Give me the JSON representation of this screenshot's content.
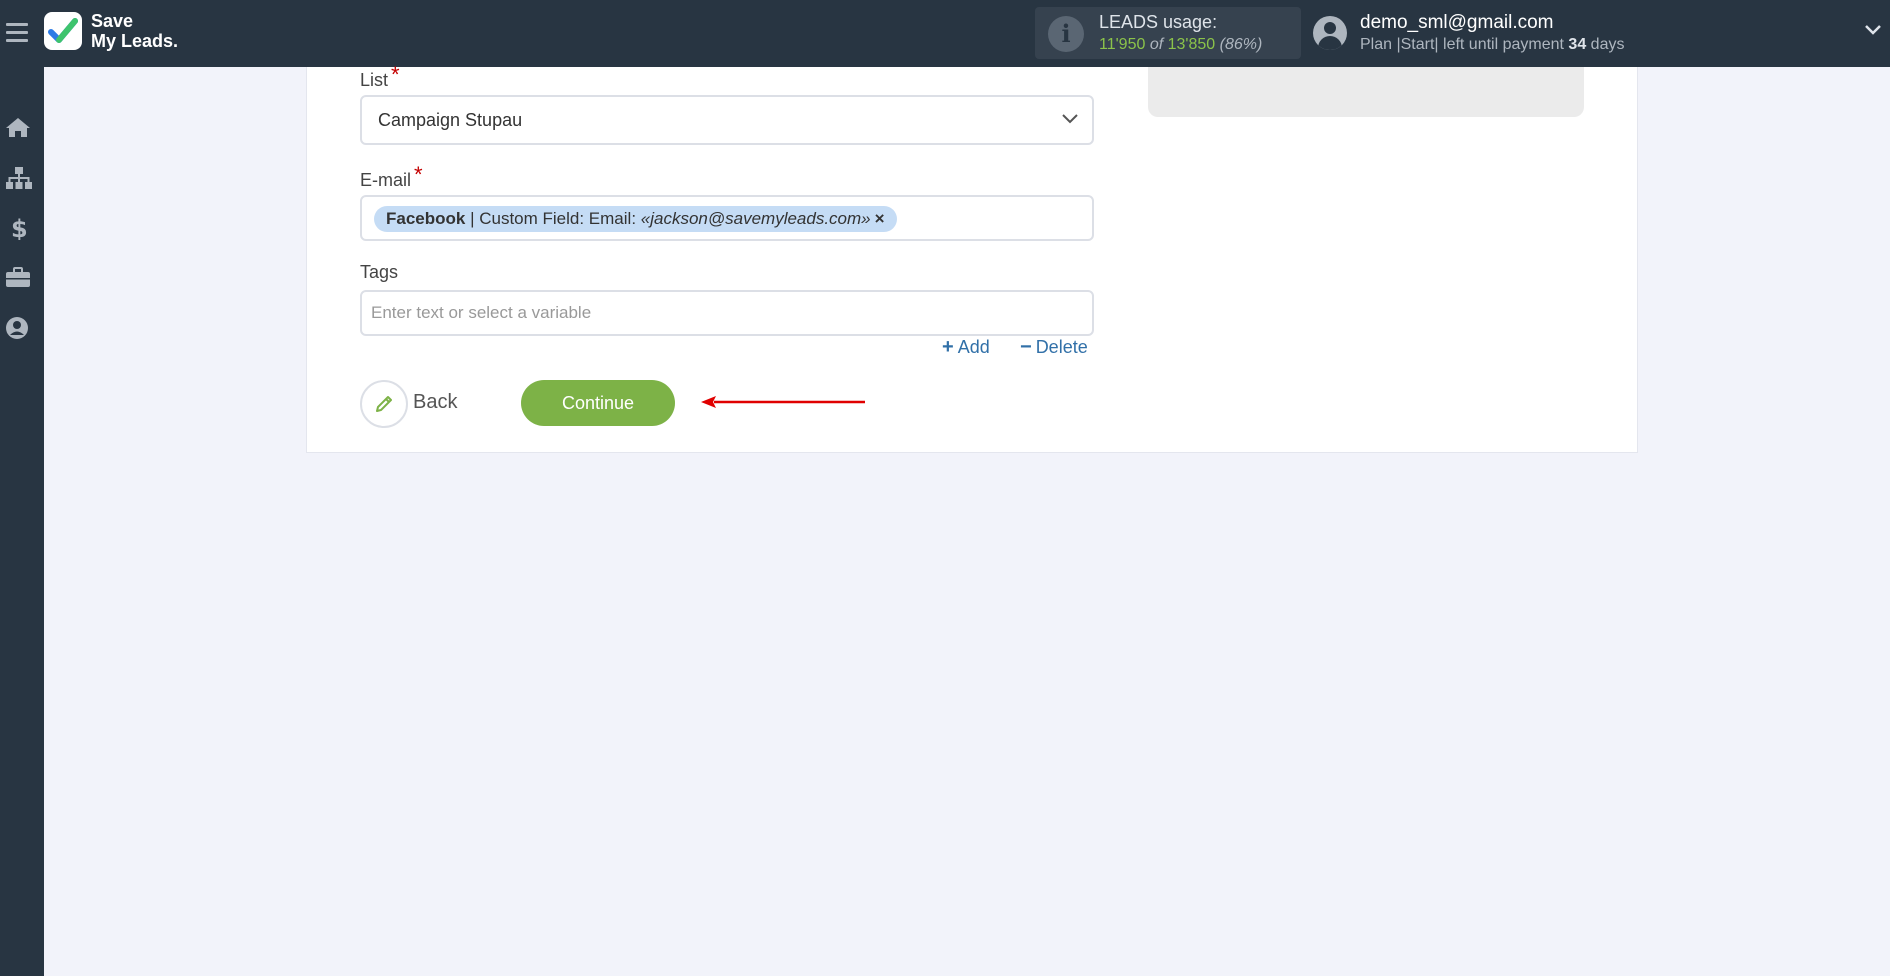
{
  "brand": {
    "line1": "Save",
    "line2": "My Leads."
  },
  "usage": {
    "title": "LEADS usage:",
    "used": "11'950",
    "of": "of",
    "total": "13'850",
    "percent": "(86%)"
  },
  "user": {
    "email": "demo_sml@gmail.com",
    "plan_prefix": "Plan |Start| left until payment",
    "days": "34",
    "days_suffix": "days"
  },
  "sidebar": {
    "items": [
      "home-icon",
      "sitemap-icon",
      "dollar-icon",
      "briefcase-icon",
      "user-circle-icon"
    ]
  },
  "form": {
    "list": {
      "label": "List",
      "required": "*",
      "value": "Campaign Stupau"
    },
    "email": {
      "label": "E-mail",
      "required": "*",
      "chip": {
        "source": "Facebook",
        "field": " | Custom Field: Email: ",
        "value": "«jackson@savemyleads.com»",
        "remove": "×"
      }
    },
    "tags": {
      "label": "Tags",
      "placeholder": "Enter text or select a variable"
    },
    "add_label": "Add",
    "delete_label": "Delete",
    "back_label": "Back",
    "continue_label": "Continue"
  },
  "colors": {
    "topbar": "#283542",
    "accent_green": "#7db247",
    "link_blue": "#3170a8",
    "arrow_red": "#e00000"
  }
}
